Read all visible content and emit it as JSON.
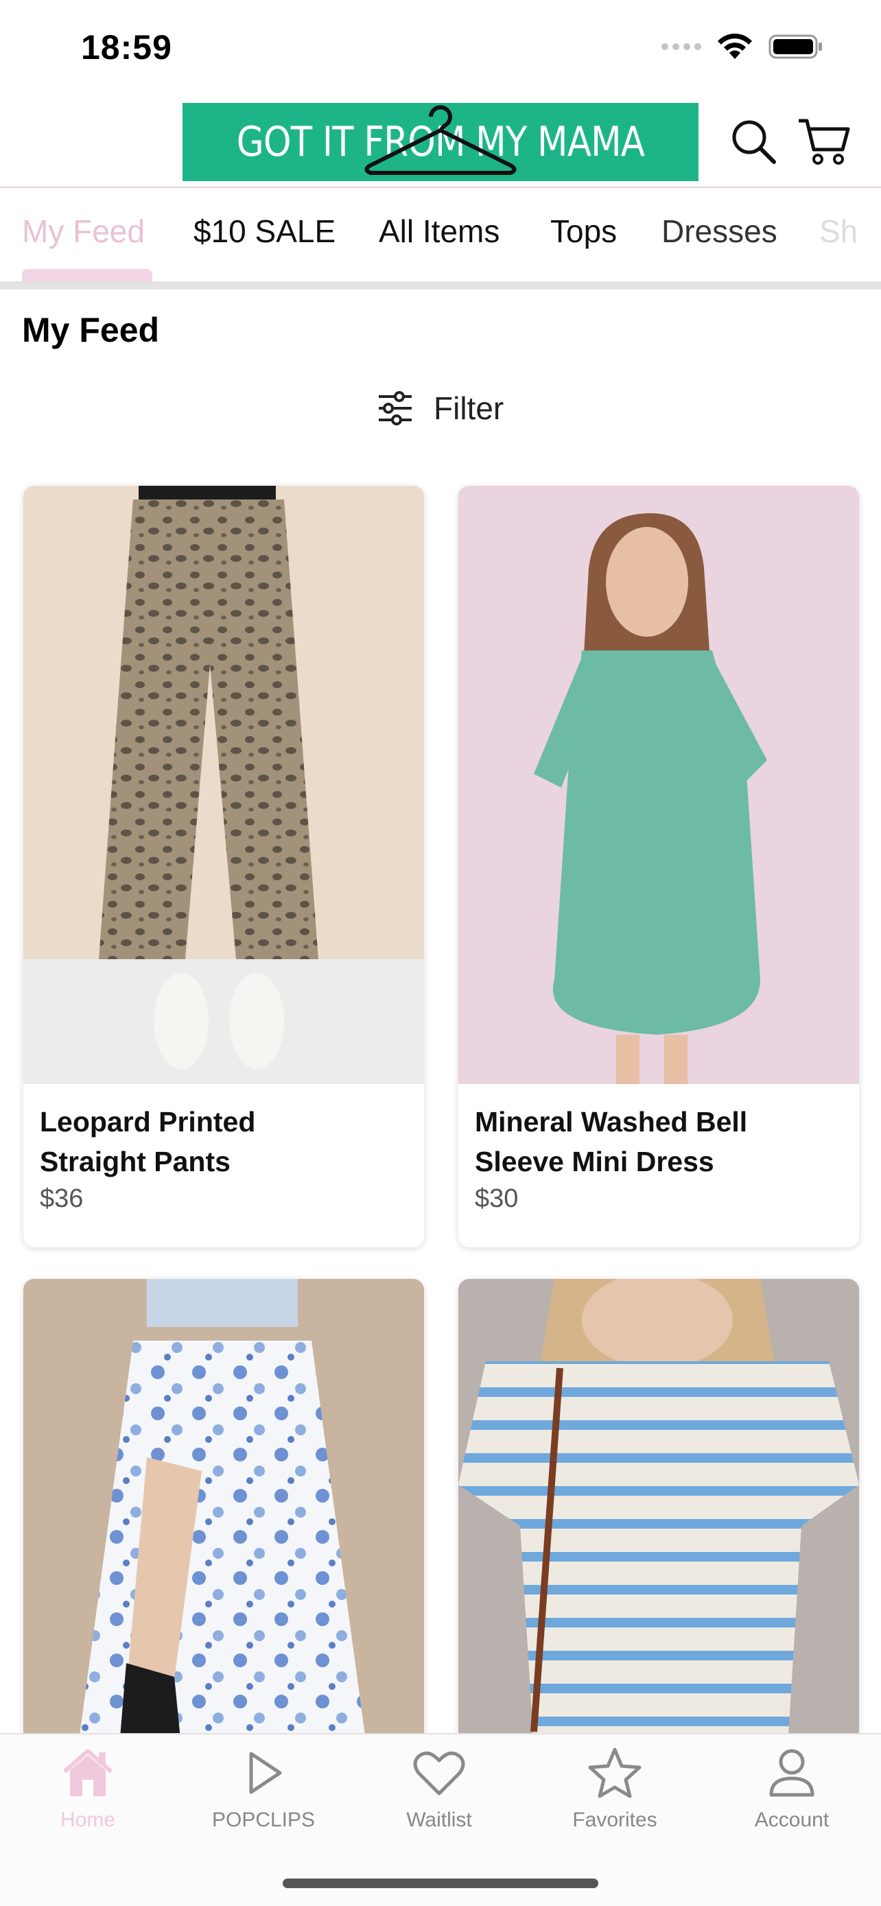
{
  "status_bar": {
    "time": "18:59"
  },
  "header": {
    "logo_text": "GOT IT FROM MY MAMA",
    "brand_color": "#1db588",
    "search_icon": "search-icon",
    "cart_icon": "cart-icon"
  },
  "tabs": [
    {
      "label": "My Feed",
      "active": true
    },
    {
      "label": "$10 SALE"
    },
    {
      "label": "All Items"
    },
    {
      "label": "Tops"
    },
    {
      "label": "Dresses"
    },
    {
      "label": "Sh"
    }
  ],
  "page": {
    "title": "My Feed",
    "filter_label": "Filter"
  },
  "products": [
    {
      "name": "Leopard Printed Straight Pants",
      "price": "$36"
    },
    {
      "name": "Mineral Washed Bell Sleeve Mini Dress",
      "price": "$30"
    },
    {
      "name": "",
      "price": ""
    },
    {
      "name": "",
      "price": ""
    }
  ],
  "bottom_nav": [
    {
      "label": "Home",
      "icon": "home-icon",
      "active": true
    },
    {
      "label": "POPCLIPS",
      "icon": "play-icon"
    },
    {
      "label": "Waitlist",
      "icon": "heart-icon"
    },
    {
      "label": "Favorites",
      "icon": "star-icon"
    },
    {
      "label": "Account",
      "icon": "person-icon"
    }
  ],
  "colors": {
    "accent_pink": "#f0c9dc",
    "text": "#111111",
    "muted": "#888888"
  }
}
